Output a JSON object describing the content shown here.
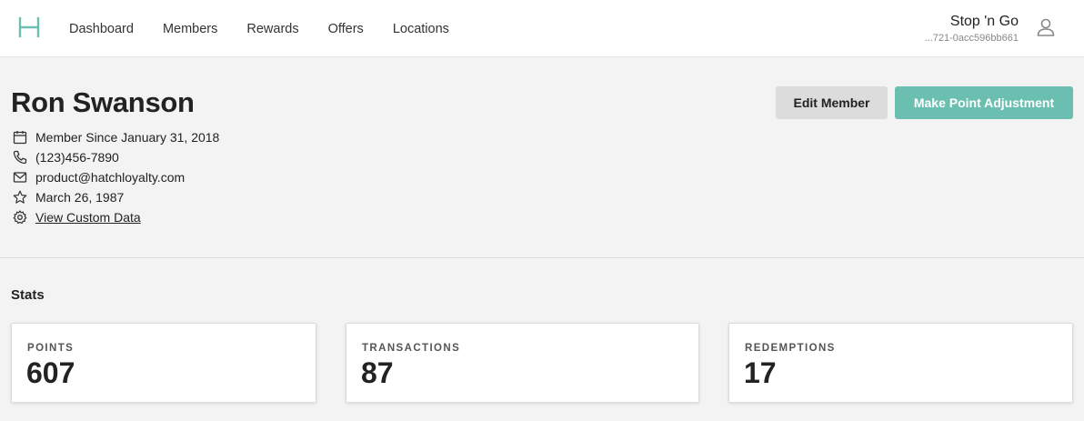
{
  "brand": {
    "logo_letter": "H",
    "accent_color": "#6bbfb0"
  },
  "nav": {
    "items": [
      {
        "label": "Dashboard"
      },
      {
        "label": "Members"
      },
      {
        "label": "Rewards"
      },
      {
        "label": "Offers"
      },
      {
        "label": "Locations"
      }
    ]
  },
  "account": {
    "store_name": "Stop 'n Go",
    "account_id": "...721-0acc596bb661",
    "icon": "user-icon"
  },
  "member": {
    "name": "Ron Swanson",
    "member_since": "Member Since January 31, 2018",
    "phone": "(123)456-7890",
    "email": "product@hatchloyalty.com",
    "birthday": "March 26, 1987",
    "custom_data_link": "View Custom Data"
  },
  "actions": {
    "edit_label": "Edit Member",
    "adjust_label": "Make Point Adjustment"
  },
  "stats": {
    "title": "Stats",
    "cards": [
      {
        "label": "POINTS",
        "value": "607"
      },
      {
        "label": "TRANSACTIONS",
        "value": "87"
      },
      {
        "label": "REDEMPTIONS",
        "value": "17"
      }
    ]
  }
}
